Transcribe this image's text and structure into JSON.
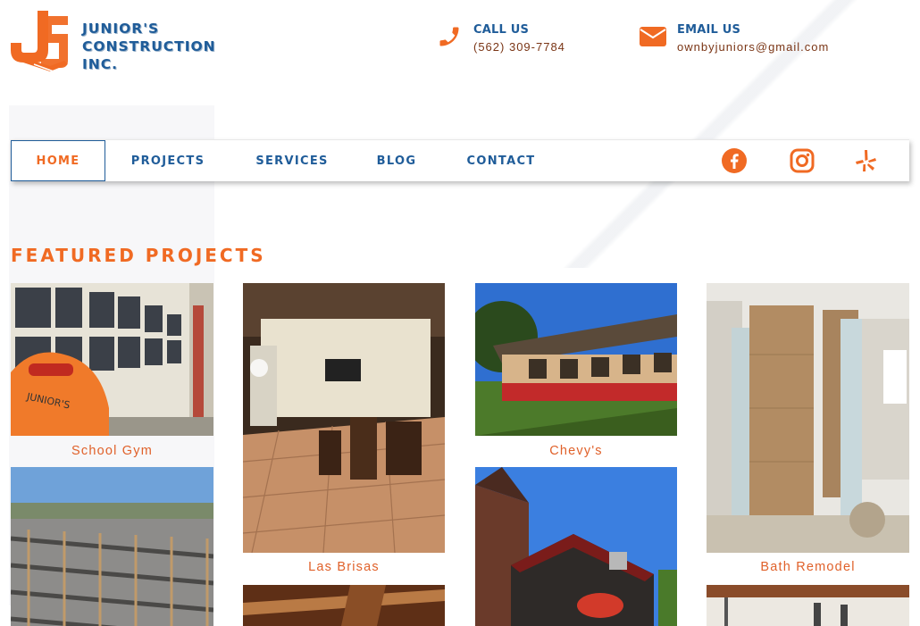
{
  "brand": {
    "line1": "JUNIOR'S",
    "line2": "CONSTRUCTION",
    "line3": "INC.",
    "colors": {
      "blue": "#1f5c99",
      "orange": "#f06a23"
    }
  },
  "contact": {
    "call": {
      "title": "CALL US",
      "value": "(562) 309-7784",
      "icon": "phone-icon"
    },
    "email": {
      "title": "EMAIL US",
      "value": "ownbyjuniors@gmail.com",
      "icon": "envelope-icon"
    }
  },
  "nav": {
    "items": [
      {
        "label": "HOME",
        "active": true
      },
      {
        "label": "PROJECTS",
        "active": false
      },
      {
        "label": "SERVICES",
        "active": false
      },
      {
        "label": "BLOG",
        "active": false
      },
      {
        "label": "CONTACT",
        "active": false
      }
    ],
    "social": [
      "facebook-icon",
      "instagram-icon",
      "yelp-icon"
    ]
  },
  "featured": {
    "title": "FEATURED PROJECTS",
    "projects": [
      {
        "caption": "School Gym"
      },
      {
        "caption": "Las Brisas"
      },
      {
        "caption": "Chevy's"
      },
      {
        "caption": "Bath Remodel"
      }
    ]
  }
}
